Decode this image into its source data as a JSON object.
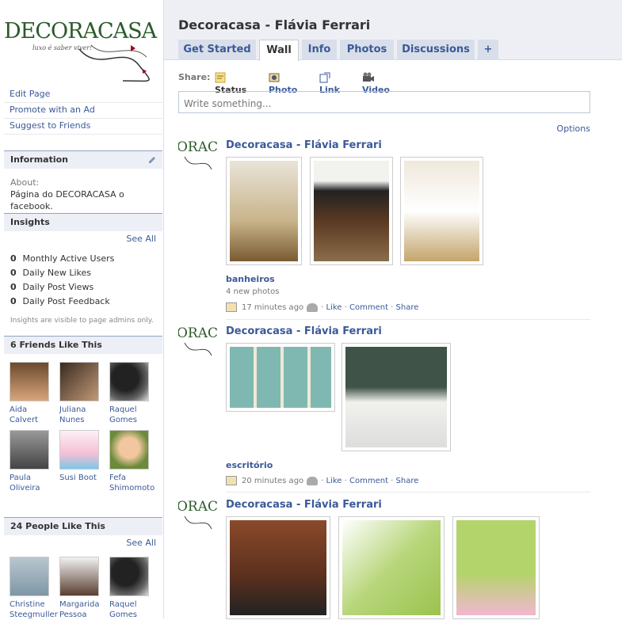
{
  "page": {
    "name": "Decoracasa - Flávia Ferrari"
  },
  "logo": {
    "brand": "DECORACASA",
    "tagline": "luxo é saber viver!"
  },
  "left_links": [
    "Edit Page",
    "Promote with an Ad",
    "Suggest to Friends"
  ],
  "information": {
    "heading": "Information",
    "about_label": "About:",
    "about_text": "Página do DECORACASA o facebook."
  },
  "insights": {
    "heading": "Insights",
    "see_all": "See All",
    "rows": [
      {
        "value": "0",
        "label": "Monthly Active Users"
      },
      {
        "value": "0",
        "label": "Daily New Likes"
      },
      {
        "value": "0",
        "label": "Daily Post Views"
      },
      {
        "value": "0",
        "label": "Daily Post Feedback"
      }
    ],
    "note": "Insights are visible to page admins only."
  },
  "friends_like": {
    "heading": "6 Friends Like This",
    "people": [
      {
        "first": "Aida",
        "last": "Calvert"
      },
      {
        "first": "Juliana",
        "last": "Nunes"
      },
      {
        "first": "Raquel",
        "last": "Gomes"
      },
      {
        "first": "Paula",
        "last": "Oliveira"
      },
      {
        "first": "Susi Boot",
        "last": ""
      },
      {
        "first": "Fefa",
        "last": "Shimomoto"
      }
    ]
  },
  "people_like": {
    "heading": "24 People Like This",
    "see_all": "See All",
    "people": [
      {
        "first": "Christine",
        "last": "Steegmuller"
      },
      {
        "first": "Margarida",
        "last": "Pessoa"
      },
      {
        "first": "Raquel",
        "last": "Gomes"
      }
    ]
  },
  "tabs": [
    "Get Started",
    "Wall",
    "Info",
    "Photos",
    "Discussions",
    "+"
  ],
  "share": {
    "label": "Share:",
    "options": [
      "Status",
      "Photo",
      "Link",
      "Video"
    ],
    "placeholder": "Write something..."
  },
  "options_label": "Options",
  "posts": [
    {
      "author": "Decoracasa - Flávia Ferrari",
      "album": "banheiros",
      "new_photos": "4 new photos",
      "time": "17 minutes ago",
      "actions": [
        "Like",
        "Comment",
        "Share"
      ]
    },
    {
      "author": "Decoracasa - Flávia Ferrari",
      "album": "escritório",
      "new_photos": "",
      "time": "20 minutes ago",
      "actions": [
        "Like",
        "Comment",
        "Share"
      ]
    },
    {
      "author": "Decoracasa - Flávia Ferrari",
      "album": "",
      "new_photos": "",
      "time": "",
      "actions": []
    }
  ],
  "colors": {
    "link": "#3b5998",
    "header_bg": "#edeff4",
    "tab_bg": "#d8dfea",
    "box_head": "#eceff5"
  }
}
